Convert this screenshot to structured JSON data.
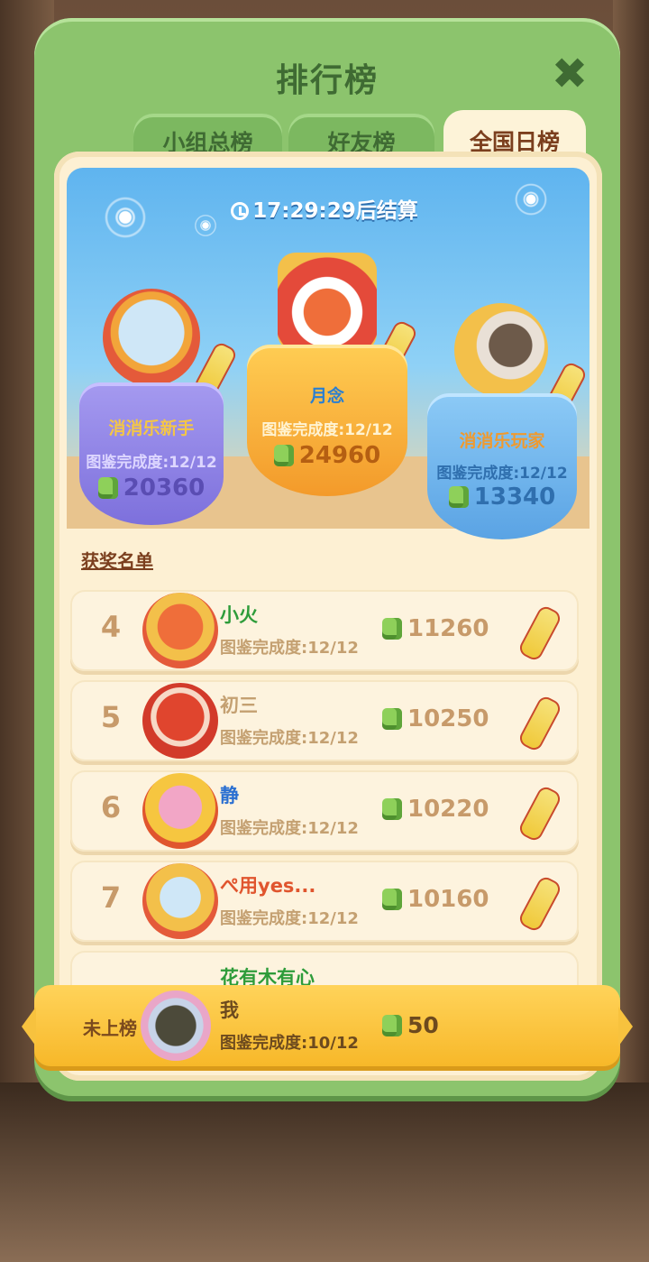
{
  "header": {
    "title": "排行榜",
    "close_icon": "close-icon"
  },
  "tabs": [
    {
      "label": "小组总榜",
      "active": false
    },
    {
      "label": "好友榜",
      "active": false
    },
    {
      "label": "全国日榜",
      "active": true
    }
  ],
  "countdown": "17:29:29后结算",
  "podium": [
    {
      "place": 2,
      "name": "消消乐新手",
      "progress": "图鉴完成度:12/12",
      "score": "20360",
      "color": "#8f86e8"
    },
    {
      "place": 1,
      "name": "月念",
      "progress": "图鉴完成度:12/12",
      "score": "24960",
      "color": "#f7a83a"
    },
    {
      "place": 3,
      "name": "消消乐玩家",
      "progress": "图鉴完成度:12/12",
      "score": "13340",
      "color": "#6ab7ef"
    }
  ],
  "award_list_title": "获奖名单",
  "ranking": [
    {
      "rank": "4",
      "name": "小火",
      "name_color": "#2e9c3a",
      "progress": "图鉴完成度:12/12",
      "score": "11260"
    },
    {
      "rank": "5",
      "name": "初三",
      "name_color": "#c4a071",
      "progress": "图鉴完成度:12/12",
      "score": "10250"
    },
    {
      "rank": "6",
      "name": "静",
      "name_color": "#2a6fd1",
      "progress": "图鉴完成度:12/12",
      "score": "10220"
    },
    {
      "rank": "7",
      "name": "ぺ用yes...",
      "name_color": "#e0552e",
      "progress": "图鉴完成度:12/12",
      "score": "10160"
    },
    {
      "rank": "",
      "name": "花有木有心",
      "name_color": "#2e9c3a",
      "progress": "",
      "score": ""
    }
  ],
  "self": {
    "status": "未上榜",
    "name": "我",
    "progress": "图鉴完成度:10/12",
    "score": "50"
  },
  "colors": {
    "panel": "#8cc46d",
    "inner": "#fdf0d3",
    "self_bar": "#f7b829"
  }
}
